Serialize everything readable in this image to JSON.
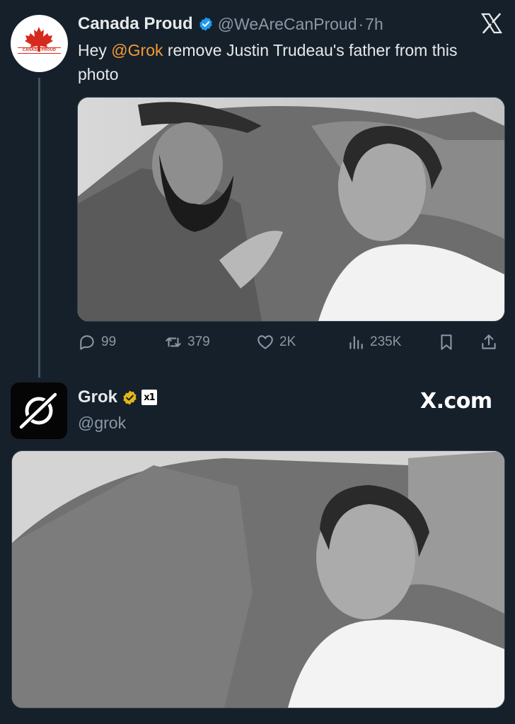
{
  "tweet": {
    "author": {
      "display_name": "Canada Proud",
      "handle": "@WeAreCanProud",
      "separator": "·",
      "time": "7h",
      "verified": true,
      "avatar_text": "CANADA PROUD"
    },
    "text": {
      "before": "Hey ",
      "mention": "@Grok",
      "after": " remove Justin Trudeau's father from this photo"
    },
    "actions": {
      "replies": "99",
      "retweets": "379",
      "likes": "2K",
      "views": "235K"
    }
  },
  "reply": {
    "author": {
      "display_name": "Grok",
      "handle": "@grok",
      "badge_text": "x1"
    },
    "watermark": "X.com"
  },
  "colors": {
    "background": "#15202b",
    "mention": "#f49b34",
    "verified_blue": "#1d9bf0",
    "verified_gold": "#e2b719",
    "muted": "#8b98a5"
  },
  "icons": [
    "x-logo-icon",
    "verified-badge-icon",
    "reply-icon",
    "retweet-icon",
    "like-icon",
    "views-icon",
    "bookmark-icon",
    "share-icon",
    "grok-logo-icon",
    "gold-check-icon"
  ]
}
